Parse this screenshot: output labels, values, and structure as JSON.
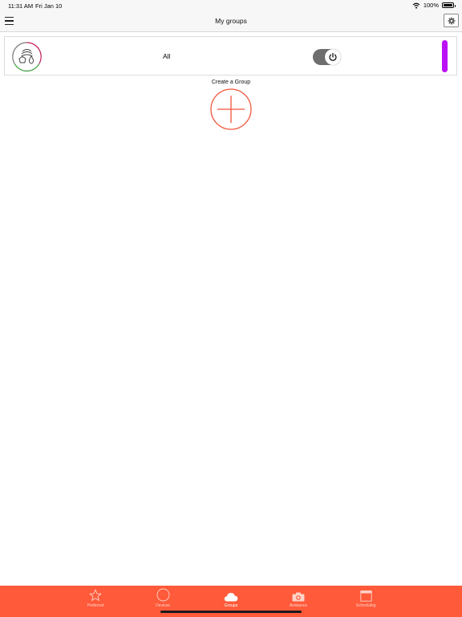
{
  "status_bar": {
    "time": "11:31 AM",
    "date": "Fri Jan 10",
    "battery": "100%",
    "icons": [
      "wifi-icon",
      "battery-icon"
    ]
  },
  "nav": {
    "title": "My groups",
    "left_icon": "hamburger-menu-icon",
    "right_icon": "gear-icon"
  },
  "groups": [
    {
      "name": "All",
      "icon": "lamps-group-icon",
      "power_on": true,
      "indicator_color": "#bb10f6"
    }
  ],
  "create_group": {
    "label": "Create a Group",
    "icon": "plus-icon",
    "color": "#f2553a"
  },
  "tabs": [
    {
      "label": "Preferred",
      "icon": "star-icon",
      "active": false
    },
    {
      "label": "Devices",
      "icon": "circle-icon",
      "active": false
    },
    {
      "label": "Groups",
      "icon": "cloud-icon",
      "active": true
    },
    {
      "label": "Ambiance",
      "icon": "camera-icon",
      "active": false
    },
    {
      "label": "Scheduling",
      "icon": "calendar-icon",
      "active": false
    }
  ],
  "colors": {
    "tab_bar": "#ff5a3a",
    "accent": "#f2553a",
    "toggle_track": "#6e6e6e"
  }
}
